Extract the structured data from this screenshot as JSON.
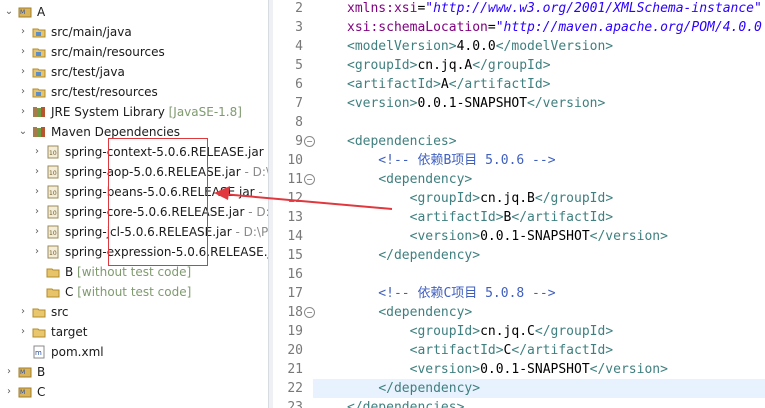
{
  "tree": {
    "items": [
      {
        "label": "A",
        "decoration": "",
        "path": "",
        "icon": "maven-project-icon",
        "expanded": true
      },
      {
        "label": "src/main/java",
        "decoration": "",
        "path": "",
        "icon": "source-folder-icon",
        "expanded": false
      },
      {
        "label": "src/main/resources",
        "decoration": "",
        "path": "",
        "icon": "source-folder-icon",
        "expanded": false
      },
      {
        "label": "src/test/java",
        "decoration": "",
        "path": "",
        "icon": "source-folder-icon",
        "expanded": false
      },
      {
        "label": "src/test/resources",
        "decoration": "",
        "path": "",
        "icon": "source-folder-icon",
        "expanded": false
      },
      {
        "label": "JRE System Library",
        "decoration": "[JavaSE-1.8]",
        "path": "",
        "icon": "library-icon",
        "expanded": false
      },
      {
        "label": "Maven Dependencies",
        "decoration": "",
        "path": "",
        "icon": "library-icon",
        "expanded": true
      },
      {
        "label": "spring-context-5.0.6.RELEASE.jar",
        "decoration": "",
        "path": "-",
        "icon": "jar-icon",
        "expanded": false
      },
      {
        "label": "spring-aop-5.0.6.RELEASE.jar",
        "decoration": "",
        "path": "- D:\\",
        "icon": "jar-icon",
        "expanded": false
      },
      {
        "label": "spring-beans-5.0.6.RELEASE.jar",
        "decoration": "",
        "path": "- |",
        "icon": "jar-icon",
        "expanded": false
      },
      {
        "label": "spring-core-5.0.6.RELEASE.jar",
        "decoration": "",
        "path": "- D:",
        "icon": "jar-icon",
        "expanded": false
      },
      {
        "label": "spring-jcl-5.0.6.RELEASE.jar",
        "decoration": "",
        "path": "- D:\\P",
        "icon": "jar-icon",
        "expanded": false
      },
      {
        "label": "spring-expression-5.0.6.RELEASE.j",
        "decoration": "",
        "path": "",
        "icon": "jar-icon",
        "expanded": false
      },
      {
        "label": "B",
        "decoration": "[without test code]",
        "path": "",
        "icon": "project-folder-icon",
        "expanded": null
      },
      {
        "label": "C",
        "decoration": "[without test code]",
        "path": "",
        "icon": "project-folder-icon",
        "expanded": null
      },
      {
        "label": "src",
        "decoration": "",
        "path": "",
        "icon": "folder-icon",
        "expanded": false
      },
      {
        "label": "target",
        "decoration": "",
        "path": "",
        "icon": "folder-icon",
        "expanded": false
      },
      {
        "label": "pom.xml",
        "decoration": "",
        "path": "",
        "icon": "pom-file-icon",
        "expanded": null
      },
      {
        "label": "B",
        "decoration": "",
        "path": "",
        "icon": "maven-project-icon",
        "expanded": false
      },
      {
        "label": "C",
        "decoration": "",
        "path": "",
        "icon": "maven-project-icon",
        "expanded": false
      }
    ]
  },
  "editor": {
    "lines": [
      {
        "n": "2",
        "fold": "",
        "parts": [
          {
            "t": "xmlns:xsi",
            "c": "attr"
          },
          {
            "t": "=",
            "c": "txt"
          },
          {
            "t": "\"http://www.w3.org/2001/XMLSchema-instance\"",
            "c": "str"
          }
        ]
      },
      {
        "n": "3",
        "fold": "",
        "parts": [
          {
            "t": "xsi:schemaLocation",
            "c": "attr"
          },
          {
            "t": "=",
            "c": "txt"
          },
          {
            "t": "\"http://maven.apache.org/POM/4.0.0",
            "c": "str"
          }
        ]
      },
      {
        "n": "4",
        "fold": "",
        "parts": [
          {
            "t": "<modelVersion>",
            "c": "tag"
          },
          {
            "t": "4.0.0",
            "c": "txt"
          },
          {
            "t": "</modelVersion>",
            "c": "tag"
          }
        ]
      },
      {
        "n": "5",
        "fold": "",
        "parts": [
          {
            "t": "<groupId>",
            "c": "tag"
          },
          {
            "t": "cn.jq.A",
            "c": "txt"
          },
          {
            "t": "</groupId>",
            "c": "tag"
          }
        ]
      },
      {
        "n": "6",
        "fold": "",
        "parts": [
          {
            "t": "<artifactId>",
            "c": "tag"
          },
          {
            "t": "A",
            "c": "txt"
          },
          {
            "t": "</artifactId>",
            "c": "tag"
          }
        ]
      },
      {
        "n": "7",
        "fold": "",
        "parts": [
          {
            "t": "<version>",
            "c": "tag"
          },
          {
            "t": "0.0.1-SNAPSHOT",
            "c": "txt"
          },
          {
            "t": "</version>",
            "c": "tag"
          }
        ]
      },
      {
        "n": "8",
        "fold": "",
        "parts": []
      },
      {
        "n": "9",
        "fold": "−",
        "parts": [
          {
            "t": "<dependencies>",
            "c": "tag"
          }
        ]
      },
      {
        "n": "10",
        "fold": "",
        "parts": [
          {
            "t": "    <!-- 依赖B项目 5.0.6 -->",
            "c": "cmt"
          }
        ]
      },
      {
        "n": "11",
        "fold": "−",
        "parts": [
          {
            "t": "    ",
            "c": "txt"
          },
          {
            "t": "<dependency>",
            "c": "tag"
          }
        ]
      },
      {
        "n": "12",
        "fold": "",
        "parts": [
          {
            "t": "        ",
            "c": "txt"
          },
          {
            "t": "<groupId>",
            "c": "tag"
          },
          {
            "t": "cn.jq.B",
            "c": "txt"
          },
          {
            "t": "</groupId>",
            "c": "tag"
          }
        ]
      },
      {
        "n": "13",
        "fold": "",
        "parts": [
          {
            "t": "        ",
            "c": "txt"
          },
          {
            "t": "<artifactId>",
            "c": "tag"
          },
          {
            "t": "B",
            "c": "txt"
          },
          {
            "t": "</artifactId>",
            "c": "tag"
          }
        ]
      },
      {
        "n": "14",
        "fold": "",
        "parts": [
          {
            "t": "        ",
            "c": "txt"
          },
          {
            "t": "<version>",
            "c": "tag"
          },
          {
            "t": "0.0.1-SNAPSHOT",
            "c": "txt"
          },
          {
            "t": "</version>",
            "c": "tag"
          }
        ]
      },
      {
        "n": "15",
        "fold": "",
        "parts": [
          {
            "t": "    ",
            "c": "txt"
          },
          {
            "t": "</dependency>",
            "c": "tag"
          }
        ]
      },
      {
        "n": "16",
        "fold": "",
        "parts": []
      },
      {
        "n": "17",
        "fold": "",
        "parts": [
          {
            "t": "    <!-- 依赖C项目 5.0.8 -->",
            "c": "cmt"
          }
        ]
      },
      {
        "n": "18",
        "fold": "−",
        "parts": [
          {
            "t": "    ",
            "c": "txt"
          },
          {
            "t": "<dependency>",
            "c": "tag"
          }
        ]
      },
      {
        "n": "19",
        "fold": "",
        "parts": [
          {
            "t": "        ",
            "c": "txt"
          },
          {
            "t": "<groupId>",
            "c": "tag"
          },
          {
            "t": "cn.jq.C",
            "c": "txt"
          },
          {
            "t": "</groupId>",
            "c": "tag"
          }
        ]
      },
      {
        "n": "20",
        "fold": "",
        "parts": [
          {
            "t": "        ",
            "c": "txt"
          },
          {
            "t": "<artifactId>",
            "c": "tag"
          },
          {
            "t": "C",
            "c": "txt"
          },
          {
            "t": "</artifactId>",
            "c": "tag"
          }
        ]
      },
      {
        "n": "21",
        "fold": "",
        "parts": [
          {
            "t": "        ",
            "c": "txt"
          },
          {
            "t": "<version>",
            "c": "tag"
          },
          {
            "t": "0.0.1-SNAPSHOT",
            "c": "txt"
          },
          {
            "t": "</version>",
            "c": "tag"
          }
        ]
      },
      {
        "n": "22",
        "fold": "",
        "parts": [
          {
            "t": "    ",
            "c": "txt"
          },
          {
            "t": "</dependency>",
            "c": "tag"
          }
        ]
      },
      {
        "n": "23",
        "fold": "",
        "parts": [
          {
            "t": "</dependencies>",
            "c": "tag"
          }
        ]
      }
    ]
  },
  "colors": {
    "annotation": "#e0383e",
    "tag": "#3f7f7f",
    "attribute": "#7f007f",
    "string": "#2a00ff",
    "comment": "#3f5fbf"
  }
}
